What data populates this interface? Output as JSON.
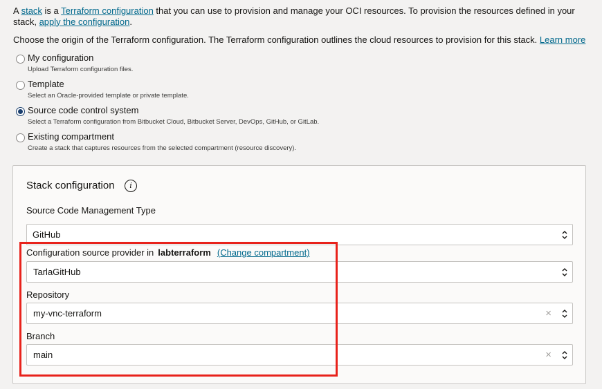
{
  "intro": {
    "prefix": "A ",
    "stack_link": "stack",
    "is_a": " is a ",
    "terraform_link": "Terraform configuration",
    "middle": " that you can use to provision and manage your OCI resources. To provision the resources defined in your stack, ",
    "apply_link": "apply the configuration",
    "suffix": "."
  },
  "choose": {
    "text": "Choose the origin of the Terraform configuration. The Terraform configuration outlines the cloud resources to provision for this stack. ",
    "learn_more": "Learn more"
  },
  "origins": [
    {
      "label": "My configuration",
      "desc": "Upload Terraform configuration files.",
      "checked": false
    },
    {
      "label": "Template",
      "desc": "Select an Oracle-provided template or private template.",
      "checked": false
    },
    {
      "label": "Source code control system",
      "desc": "Select a Terraform configuration from Bitbucket Cloud, Bitbucket Server, DevOps, GitHub, or GitLab.",
      "checked": true
    },
    {
      "label": "Existing compartment",
      "desc": "Create a stack that captures resources from the selected compartment (resource discovery).",
      "checked": false
    }
  ],
  "stack_config": {
    "title": "Stack configuration",
    "info_icon": "i",
    "scm_type_label": "Source Code Management Type",
    "scm_type_value": "GitHub",
    "provider_label": "Configuration source provider in",
    "provider_compartment": "labterraform",
    "change_compartment": "(Change compartment)",
    "provider_value": "TarlaGitHub",
    "repository_label": "Repository",
    "repository_value": "my-vnc-terraform",
    "branch_label": "Branch",
    "branch_value": "main",
    "clear_symbol": "×"
  },
  "colors": {
    "link": "#00688c",
    "highlight": "#e8221b",
    "radio_checked": "#1a3f6e"
  }
}
